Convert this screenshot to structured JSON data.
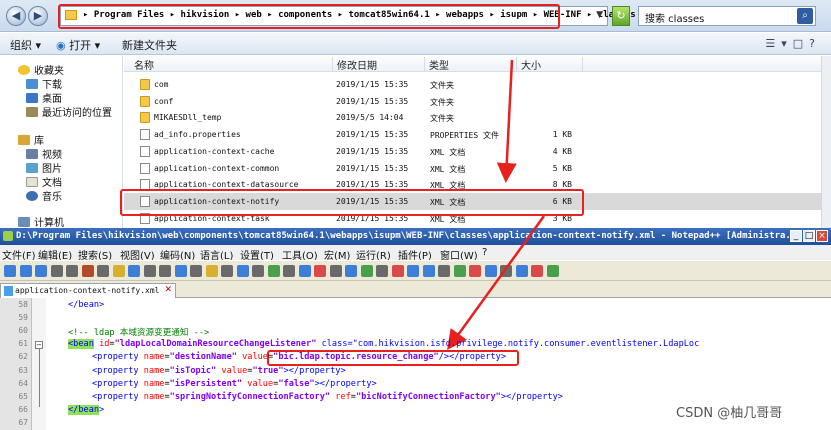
{
  "explorer": {
    "address_path": "▸ Program Files ▸ hikvision ▸ web ▸ components ▸ tomcat85win64.1 ▸ webapps ▸ isupm ▸ WEB-INF ▸ classes ▸",
    "search_text": "搜索 classes",
    "toolbar": {
      "organize": "组织 ▾",
      "open": "打开 ▾",
      "new_folder": "新建文件夹"
    },
    "nav": {
      "favorites": "收藏夹",
      "downloads": "下载",
      "desktop": "桌面",
      "recent": "最近访问的位置",
      "libraries": "库",
      "videos": "视频",
      "pictures": "图片",
      "documents": "文档",
      "music": "音乐",
      "computer": "计算机"
    },
    "columns": {
      "name": "名称",
      "modified": "修改日期",
      "type": "类型",
      "size": "大小"
    },
    "files": [
      {
        "name": "com",
        "date": "2019/1/15 15:35",
        "type": "文件夹",
        "size": "",
        "kind": "folder"
      },
      {
        "name": "conf",
        "date": "2019/1/15 15:35",
        "type": "文件夹",
        "size": "",
        "kind": "folder"
      },
      {
        "name": "MIKAESDll_temp",
        "date": "2019/5/5 14:04",
        "type": "文件夹",
        "size": "",
        "kind": "folder"
      },
      {
        "name": "ad_info.properties",
        "date": "2019/1/15 15:35",
        "type": "PROPERTIES 文件",
        "size": "1 KB",
        "kind": "doc"
      },
      {
        "name": "application-context-cache",
        "date": "2019/1/15 15:35",
        "type": "XML 文档",
        "size": "4 KB",
        "kind": "doc"
      },
      {
        "name": "application-context-common",
        "date": "2019/1/15 15:35",
        "type": "XML 文档",
        "size": "5 KB",
        "kind": "doc"
      },
      {
        "name": "application-context-datasource",
        "date": "2019/1/15 15:35",
        "type": "XML 文档",
        "size": "8 KB",
        "kind": "doc"
      },
      {
        "name": "application-context-notify",
        "date": "2019/1/15 15:35",
        "type": "XML 文档",
        "size": "6 KB",
        "kind": "doc",
        "selected": true
      },
      {
        "name": "application-context-task",
        "date": "2019/1/15 15:35",
        "type": "XML 文档",
        "size": "3 KB",
        "kind": "doc"
      }
    ]
  },
  "npp": {
    "title": "D:\\Program Files\\hikvision\\web\\components\\tomcat85win64.1\\webapps\\isupm\\WEB-INF\\classes\\application-context-notify.xml - Notepad++ [Administra...",
    "menu": [
      "文件(F)",
      "编辑(E)",
      "搜索(S)",
      "视图(V)",
      "编码(N)",
      "语言(L)",
      "设置(T)",
      "工具(O)",
      "宏(M)",
      "运行(R)",
      "插件(P)",
      "窗口(W)",
      "?"
    ],
    "tab_label": "application-context-notify.xml",
    "lines": [
      {
        "n": "58",
        "c": "    </bean>"
      },
      {
        "n": "59",
        "c": ""
      },
      {
        "n": "60",
        "c": "    <!-- ldap 本域资源变更通知 -->"
      },
      {
        "n": "61",
        "c": "<bean id=\"ldapLocalDomainResourceChangeListener\" class=\"com.hikvision.isfd.privilege.notify.consumer.eventlistener.LdapLoc"
      },
      {
        "n": "62",
        "c": "<property name=\"destionName\" value=\"bic.ldap.topic.resource_change\"/></property>"
      },
      {
        "n": "63",
        "c": "<property name=\"isTopic\" value=\"true\"></property>"
      },
      {
        "n": "64",
        "c": "<property name=\"isPersistent\" value=\"false\"></property>"
      },
      {
        "n": "65",
        "c": "<property name=\"springNotifyConnectionFactory\" ref=\"bicNotifyConnectionFactory\"></property>"
      },
      {
        "n": "66",
        "c": "</bean>"
      },
      {
        "n": "67",
        "c": ""
      }
    ]
  },
  "watermark": "CSDN @柚几哥哥",
  "colors": {
    "annotation_red": "#e8201e",
    "bean_highlight": "#8fe05a",
    "xml_tag": "#0000ff",
    "xml_attr": "#ff0000",
    "xml_value": "#8000ff"
  }
}
